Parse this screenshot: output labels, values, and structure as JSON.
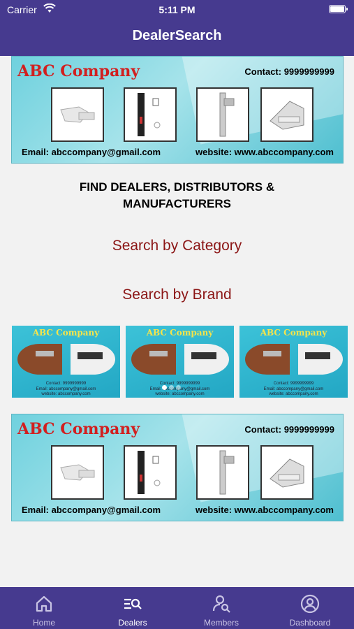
{
  "status_bar": {
    "carrier": "Carrier",
    "time": "5:11 PM"
  },
  "nav": {
    "title": "DealerSearch"
  },
  "banners": [
    {
      "brand": "ABC Company",
      "contact": "Contact: 9999999999",
      "email": "Email: abccompany@gmail.com",
      "website": "website: www.abccompany.com"
    },
    {
      "brand": "ABC Company",
      "contact": "Contact: 9999999999",
      "email": "Email: abccompany@gmail.com",
      "website": "website: www.abccompany.com"
    }
  ],
  "main": {
    "heading_line1": "FIND DEALERS, DISTRIBUTORS &",
    "heading_line2": "MANUFACTURERS",
    "search_category": "Search by Category",
    "search_brand": "Search by Brand"
  },
  "brand_cards": [
    {
      "title": "ABC Company",
      "contact": "Contact: 9999999999",
      "email": "Email: abccompany@gmail.com",
      "website": "website: abccompany.com"
    },
    {
      "title": "ABC Company",
      "contact": "Contact: 9999999999",
      "email": "Email: abccompany@gmail.com",
      "website": "website: abccompany.com"
    },
    {
      "title": "ABC Company",
      "contact": "Contact: 9999999999",
      "email": "Email: abccompany@gmail.com",
      "website": "website: abccompany.com"
    }
  ],
  "tabs": [
    {
      "label": "Home",
      "icon": "home-icon"
    },
    {
      "label": "Dealers",
      "icon": "dealers-search-icon",
      "active": true
    },
    {
      "label": "Members",
      "icon": "members-search-icon"
    },
    {
      "label": "Dashboard",
      "icon": "user-circle-icon"
    }
  ],
  "colors": {
    "primary": "#463a8f",
    "link": "#8b1515",
    "brand_red": "#d21f1f",
    "banner_teal": "#6fd1de"
  }
}
